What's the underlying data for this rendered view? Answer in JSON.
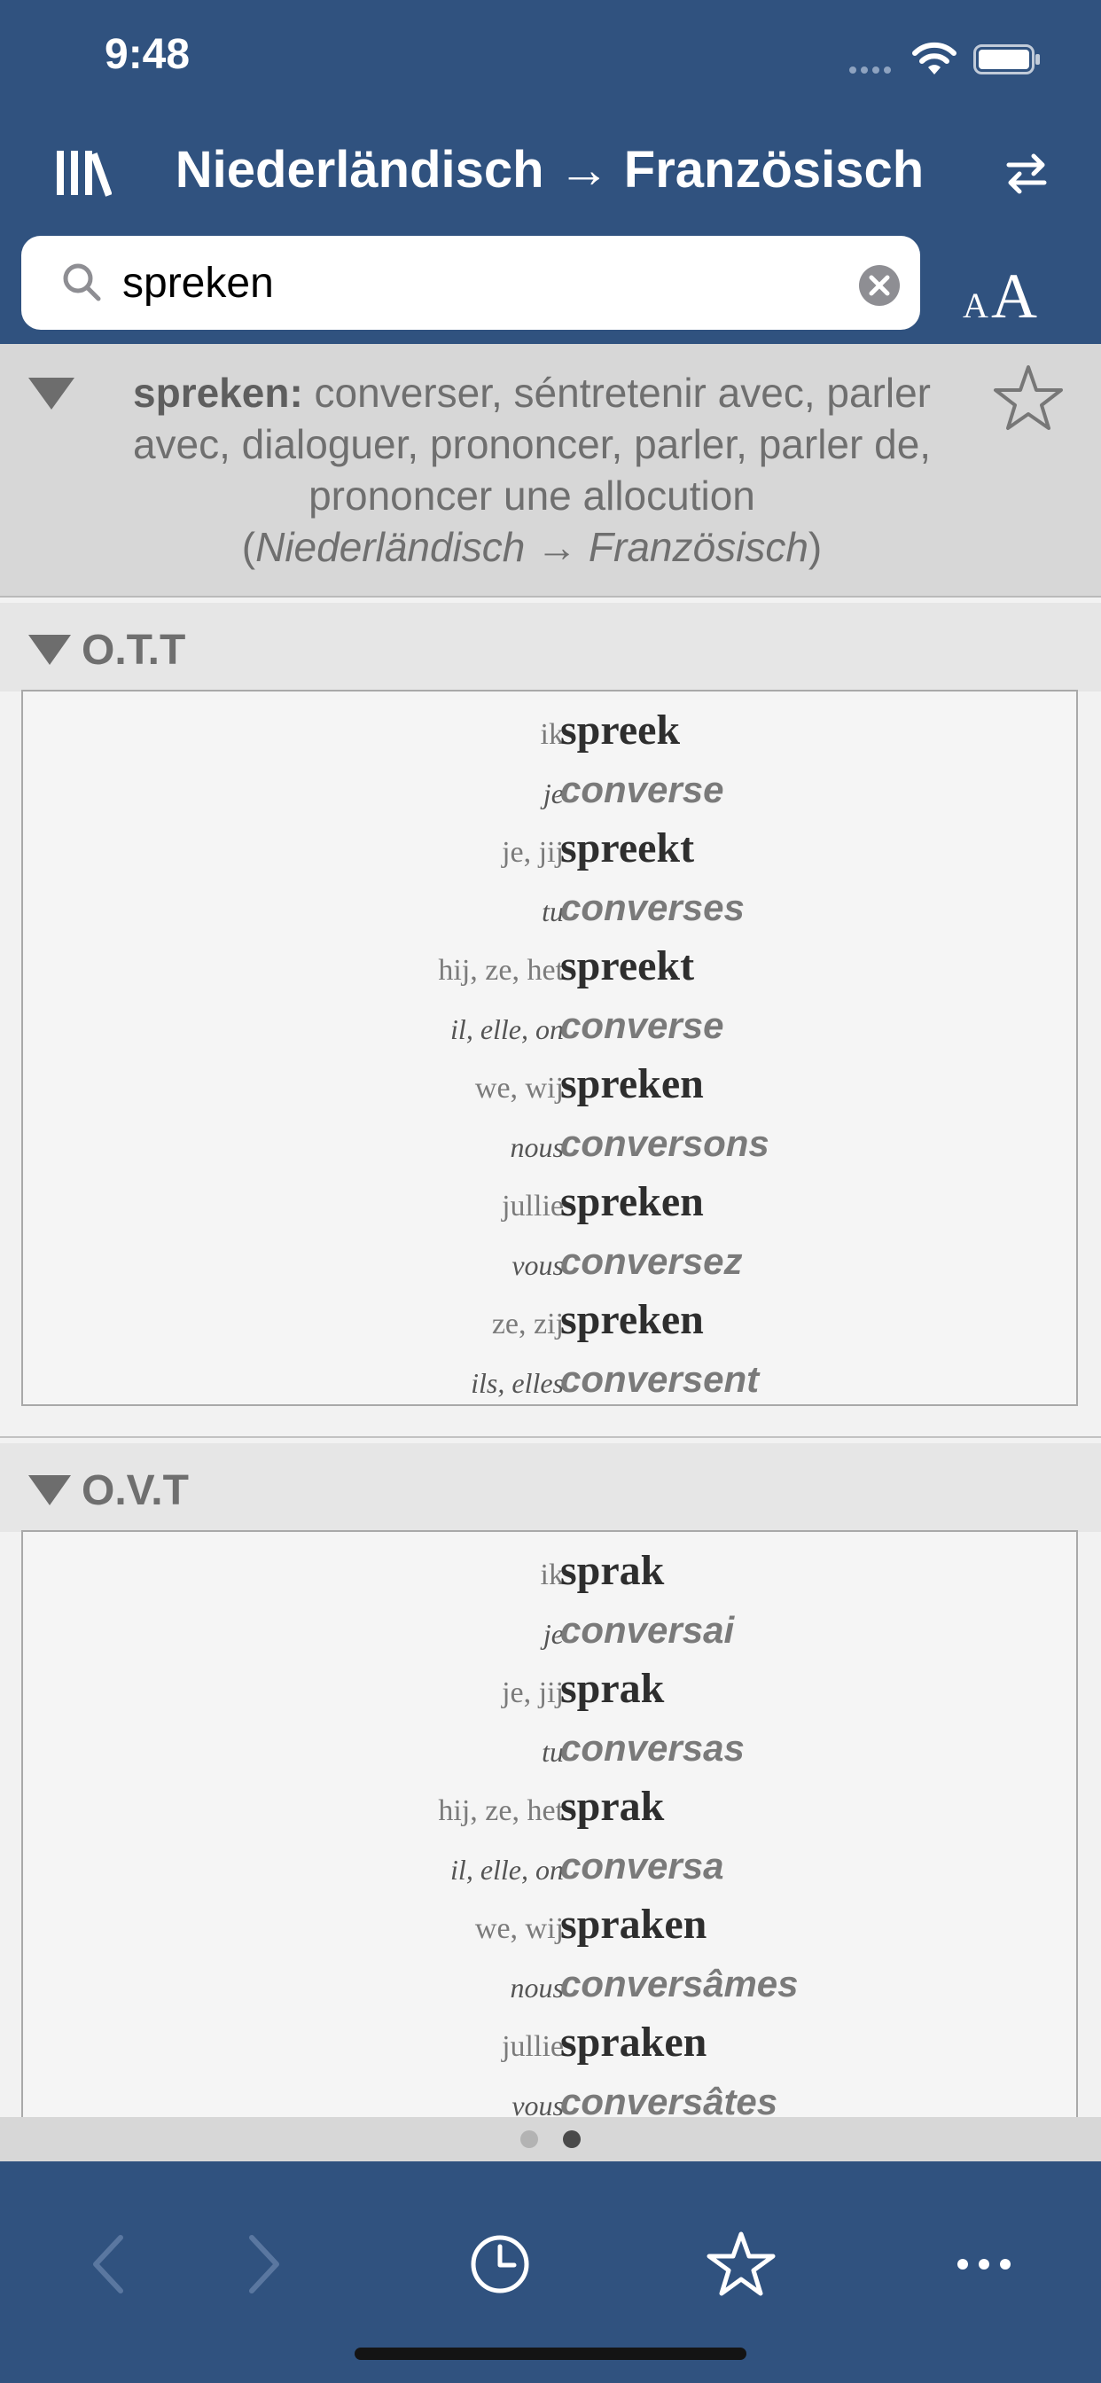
{
  "status_bar": {
    "time": "9:48"
  },
  "nav": {
    "title": "Niederländisch → Französisch"
  },
  "search": {
    "value": "spreken",
    "placeholder": ""
  },
  "entry": {
    "word": "spreken:",
    "translations": "converser, séntretenir avec, parler avec, dialoguer, prononcer, parler, parler de, prononcer une allocution",
    "direction_open": "(",
    "direction": "Niederländisch → Französisch",
    "direction_close": ")"
  },
  "sections": [
    {
      "label": "O.T.T",
      "rows": [
        {
          "pron": "ik",
          "form": "spreek",
          "lang": "nl"
        },
        {
          "pron": "je",
          "form": "converse",
          "lang": "fr"
        },
        {
          "pron": "je, jij",
          "form": "spreekt",
          "lang": "nl"
        },
        {
          "pron": "tu",
          "form": "converses",
          "lang": "fr"
        },
        {
          "pron": "hij, ze, het",
          "form": "spreekt",
          "lang": "nl"
        },
        {
          "pron": "il, elle, on",
          "form": "converse",
          "lang": "fr"
        },
        {
          "pron": "we, wij",
          "form": "spreken",
          "lang": "nl"
        },
        {
          "pron": "nous",
          "form": "conversons",
          "lang": "fr"
        },
        {
          "pron": "jullie",
          "form": "spreken",
          "lang": "nl"
        },
        {
          "pron": "vous",
          "form": "conversez",
          "lang": "fr"
        },
        {
          "pron": "ze, zij",
          "form": "spreken",
          "lang": "nl"
        },
        {
          "pron": "ils, elles",
          "form": "conversent",
          "lang": "fr"
        }
      ]
    },
    {
      "label": "O.V.T",
      "rows": [
        {
          "pron": "ik",
          "form": "sprak",
          "lang": "nl"
        },
        {
          "pron": "je",
          "form": "conversai",
          "lang": "fr"
        },
        {
          "pron": "je, jij",
          "form": "sprak",
          "lang": "nl"
        },
        {
          "pron": "tu",
          "form": "conversas",
          "lang": "fr"
        },
        {
          "pron": "hij, ze, het",
          "form": "sprak",
          "lang": "nl"
        },
        {
          "pron": "il, elle, on",
          "form": "conversa",
          "lang": "fr"
        },
        {
          "pron": "we, wij",
          "form": "spraken",
          "lang": "nl"
        },
        {
          "pron": "nous",
          "form": "conversâmes",
          "lang": "fr"
        },
        {
          "pron": "jullie",
          "form": "spraken",
          "lang": "nl"
        },
        {
          "pron": "vous",
          "form": "conversâtes",
          "lang": "fr"
        }
      ]
    }
  ],
  "pager": {
    "page_count": 2,
    "current_page": 2
  },
  "toolbar": {
    "back_enabled": false,
    "forward_enabled": false,
    "icons": [
      "back-icon",
      "forward-icon",
      "history-icon",
      "favorites-icon",
      "more-icon"
    ]
  },
  "colors": {
    "brand": "#30527f",
    "header_gray": "#d7d7d7",
    "section_gray": "#e6e6e6"
  }
}
